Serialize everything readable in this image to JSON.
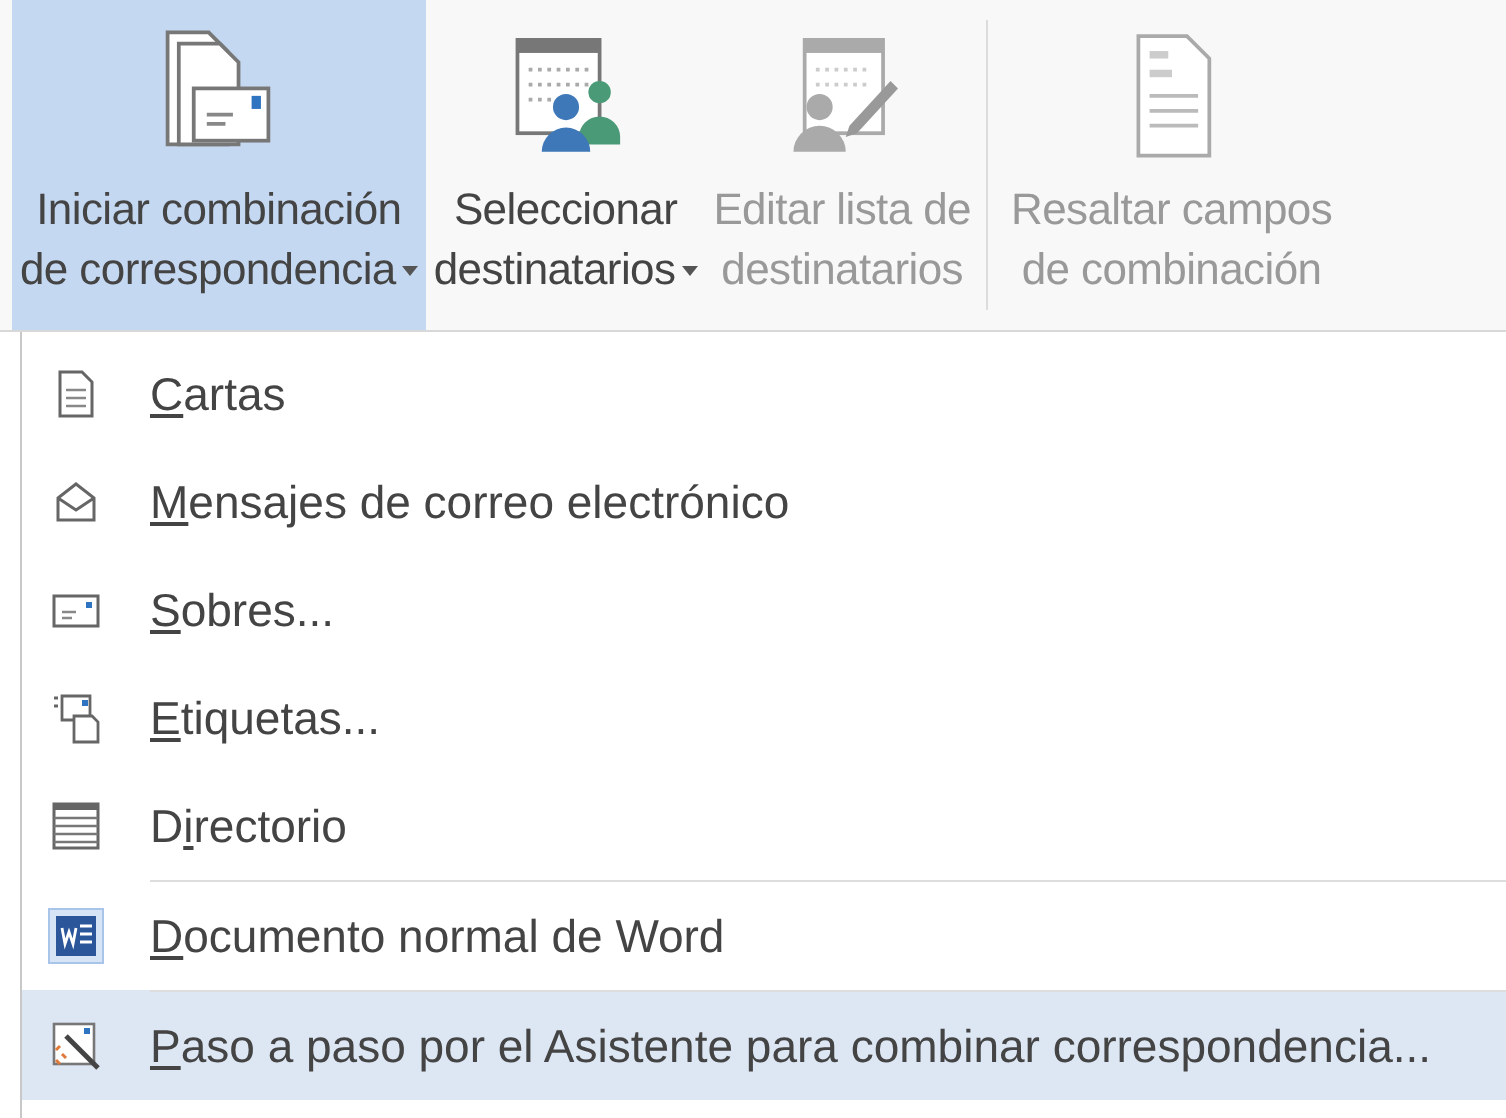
{
  "ribbon": {
    "buttons": [
      {
        "kind": "start-merge",
        "lines": [
          "Iniciar combinación",
          "de correspondencia"
        ],
        "dropdown": true,
        "selected": true,
        "disabled": false,
        "separator_before": false
      },
      {
        "kind": "recipients",
        "lines": [
          "Seleccionar",
          "destinatarios"
        ],
        "dropdown": true,
        "selected": false,
        "disabled": false,
        "separator_before": false
      },
      {
        "kind": "edit-list",
        "lines": [
          "Editar lista de",
          "destinatarios"
        ],
        "dropdown": false,
        "selected": false,
        "disabled": true,
        "separator_before": false
      },
      {
        "kind": "highlight-fields",
        "lines": [
          "Resaltar campos",
          "de combinación"
        ],
        "dropdown": false,
        "selected": false,
        "disabled": true,
        "separator_before": true
      }
    ]
  },
  "menu": {
    "items": [
      {
        "kind": "letter",
        "label": {
          "key": "C",
          "after": "artas"
        },
        "selected": false,
        "separator_before": false
      },
      {
        "kind": "email",
        "label": {
          "key": "M",
          "after": "ensajes de correo electrónico"
        },
        "selected": false,
        "separator_before": false
      },
      {
        "kind": "envelope",
        "label": {
          "key": "S",
          "after": "obres..."
        },
        "selected": false,
        "separator_before": false
      },
      {
        "kind": "labels",
        "label": {
          "key": "E",
          "after": "tiquetas..."
        },
        "selected": false,
        "separator_before": false
      },
      {
        "kind": "directory",
        "label": {
          "before": "D",
          "key": "i",
          "after": "rectorio"
        },
        "selected": false,
        "separator_before": false
      },
      {
        "kind": "word",
        "label": {
          "key": "D",
          "after": "ocumento normal de Word"
        },
        "selected": false,
        "separator_before": true
      },
      {
        "kind": "wizard",
        "label": {
          "key": "P",
          "after": "aso a paso por el Asistente para combinar correspondencia..."
        },
        "selected": true,
        "separator_before": true
      }
    ]
  }
}
